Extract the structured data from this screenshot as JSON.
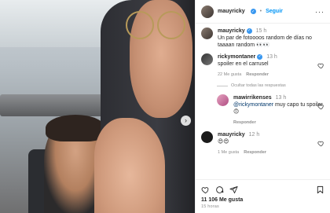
{
  "post": {
    "author": "mauyricky",
    "follow_label": "Seguir",
    "dot": "•",
    "more_icon": "more-horizontal-icon",
    "next_icon": "chevron-right-icon"
  },
  "caption": {
    "user": "mauyricky",
    "time": "15 h",
    "text": "Un par de fotoooos random de días no taaaan random",
    "emoji": "👀👀"
  },
  "comments": [
    {
      "user": "rickymontaner",
      "time": "13 h",
      "text": "spoiler en el carrusel",
      "likes": "22 Me gusta",
      "reply_label": "Responder"
    },
    {
      "user": "mauyricky",
      "time": "12 h",
      "text": "",
      "emoji": "😍😍",
      "likes": "1 Me gusta",
      "reply_label": "Responder"
    }
  ],
  "hide_replies_label": "Ocultar todas las respuestas",
  "reply": {
    "user": "mawirrikenses",
    "time": "13 h",
    "mention": "@rickymontaner",
    "text": " muy capo tu spoiler",
    "emoji": "🙃",
    "reply_label": "Responder"
  },
  "footer": {
    "likes": "11 106 Me gusta",
    "ago": "15 horas"
  },
  "colors": {
    "link": "#0095f6",
    "verified": "#3897f0",
    "muted": "#8e8e8e"
  }
}
